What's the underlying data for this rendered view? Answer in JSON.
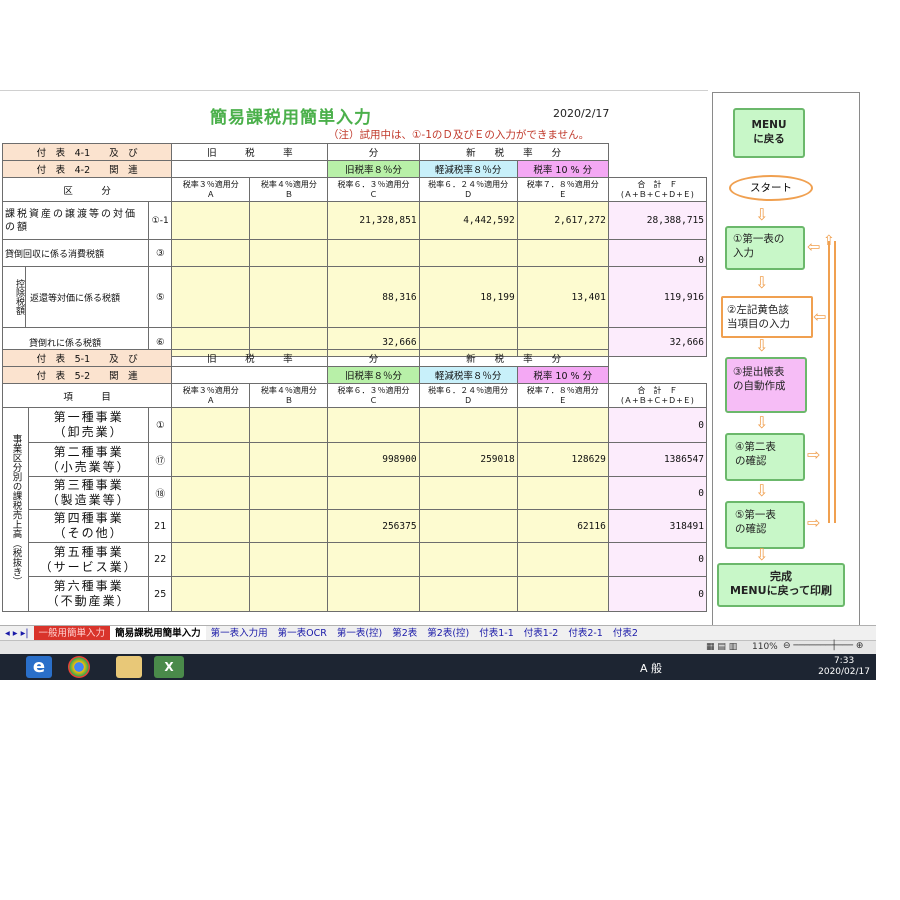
{
  "title": "簡易課税用簡単入力",
  "date": "2020/2/17",
  "note": "（注）試用中は、①-1のＤ及びＥの入力ができません。",
  "t1": {
    "hdr1": "付　表　4-1　　及　び",
    "hdr2": "付　表　4-2　　関　連",
    "old_rate": "旧　　　税　　　率",
    "bun": "分",
    "new_rate": "新　　税　　率　　分",
    "g8": "旧税率８％分",
    "r8": "軽減税率８％分",
    "r10": "税率 10 % 分",
    "kubun": "区　　　分",
    "c3": "税率３％適用分",
    "c4": "税率４％適用分",
    "c63": "税率６．３％適用分",
    "c624": "税率６．２４％適用分",
    "c78": "税率７．８％適用分",
    "total": "合　計　Ｆ",
    "total_sub": "(Ａ+Ｂ+Ｃ+Ｄ+Ｅ)",
    "lA": "Ａ",
    "lB": "Ｂ",
    "lC": "Ｃ",
    "lD": "Ｄ",
    "lE": "Ｅ",
    "row1_label": "課税資産の譲渡等の対価の額",
    "row1_no": "①-1",
    "row1": {
      "C": "21,328,851",
      "D": "4,442,592",
      "E": "2,617,272",
      "F": "28,388,715"
    },
    "row2_label": "貸倒回収に係る消費税額",
    "row2_no": "③",
    "row2": {
      "F": "0"
    },
    "kojo": "控除税額",
    "row3_label": "返還等対価に係る税額",
    "row3_no": "⑤",
    "row3": {
      "C": "88,316",
      "D": "18,199",
      "E": "13,401",
      "F": "119,916"
    },
    "row4_label": "貸倒れに係る税額",
    "row4_no": "⑥",
    "row4": {
      "C": "32,666",
      "F": "32,666"
    }
  },
  "t2": {
    "hdr1": "付　表　5-1　　及　び",
    "hdr2": "付　表　5-2　　関　連",
    "koumoku": "項　　　目",
    "side": "事業区分別の課税売上高（税抜き）",
    "rows": [
      {
        "name1": "第一種事業",
        "name2": "（卸売業）",
        "no": "①",
        "C": "",
        "D": "",
        "E": "",
        "F": "0"
      },
      {
        "name1": "第二種事業",
        "name2": "（小売業等）",
        "no": "⑰",
        "C": "998900",
        "D": "259018",
        "E": "128629",
        "F": "1386547"
      },
      {
        "name1": "第三種事業",
        "name2": "（製造業等）",
        "no": "⑱",
        "C": "",
        "D": "",
        "E": "",
        "F": "0"
      },
      {
        "name1": "第四種事業",
        "name2": "（その他）",
        "no": "21",
        "C": "256375",
        "D": "",
        "E": "62116",
        "F": "318491"
      },
      {
        "name1": "第五種事業",
        "name2": "（サービス業）",
        "no": "22",
        "C": "",
        "D": "",
        "E": "",
        "F": "0"
      },
      {
        "name1": "第六種事業",
        "name2": "（不動産業）",
        "no": "25",
        "C": "",
        "D": "",
        "E": "",
        "F": "0"
      }
    ]
  },
  "panel": {
    "menu": "MENU\nに戻る",
    "start": "スタート",
    "step1": "①第一表の\n入力",
    "step2": "②左記黄色該\n当項目の入力",
    "step3": "③提出帳表\nの自動作成",
    "step4": "④第二表\nの確認",
    "step5": "⑤第一表\nの確認",
    "done1": "完成",
    "done2": "MENUに戻って印刷"
  },
  "tabs": [
    "一般用簡単入力",
    "簡易課税用簡単入力",
    "第一表入力用",
    "第一表OCR",
    "第一表(控)",
    "第2表",
    "第2表(控)",
    "付表1-1",
    "付表1-2",
    "付表2-1",
    "付表2"
  ],
  "zoom": "110%",
  "clock": {
    "time": "7:33",
    "date": "2020/02/17"
  },
  "ime": "A 般"
}
